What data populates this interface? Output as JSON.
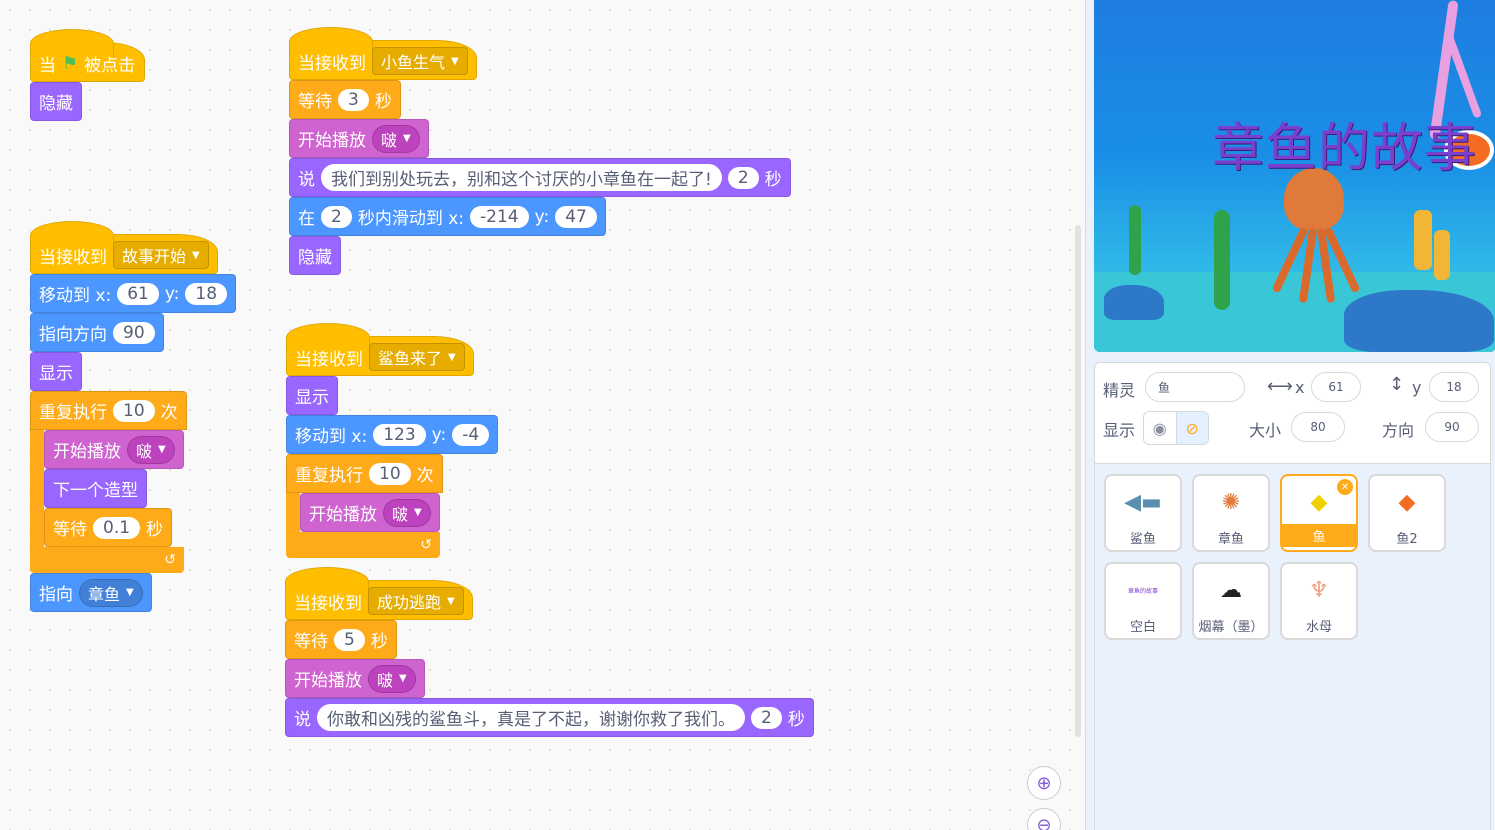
{
  "scripts": {
    "s1": {
      "hat_when": "当",
      "hat_clicked": "被点击",
      "hide": "隐藏"
    },
    "s2": {
      "hat": "当接收到",
      "msg": "故事开始",
      "goto": "移动到 x:",
      "x": "61",
      "y_lbl": "y:",
      "y": "18",
      "point_dir": "指向方向",
      "dir": "90",
      "show": "显示",
      "repeat": "重复执行",
      "times": "10",
      "times_unit": "次",
      "play": "开始播放",
      "sound": "啵",
      "next_costume": "下一个造型",
      "wait": "等待",
      "wait_val": "0.1",
      "sec": "秒",
      "point_towards": "指向",
      "target": "章鱼"
    },
    "s3": {
      "hat": "当接收到",
      "msg": "小鱼生气",
      "wait": "等待",
      "wait_val": "3",
      "sec": "秒",
      "play": "开始播放",
      "sound": "啵",
      "say": "说",
      "say_text": "我们到别处玩去，别和这个讨厌的小章鱼在一起了!",
      "say_secs": "2",
      "say_unit": "秒",
      "glide_in": "在",
      "glide_secs": "2",
      "glide_to": "秒内滑动到 x:",
      "gx": "-214",
      "gy_lbl": "y:",
      "gy": "47",
      "hide": "隐藏"
    },
    "s4": {
      "hat": "当接收到",
      "msg": "鲨鱼来了",
      "show": "显示",
      "goto": "移动到 x:",
      "x": "123",
      "y_lbl": "y:",
      "y": "-4",
      "repeat": "重复执行",
      "times": "10",
      "times_unit": "次",
      "play": "开始播放",
      "sound": "啵"
    },
    "s5": {
      "hat": "当接收到",
      "msg": "成功逃跑",
      "wait": "等待",
      "wait_val": "5",
      "sec": "秒",
      "play": "开始播放",
      "sound": "啵",
      "say": "说",
      "say_text": "你敢和凶残的鲨鱼斗，真是了不起，谢谢你救了我们。",
      "say_secs": "2",
      "say_unit": "秒"
    }
  },
  "stage": {
    "title": "章鱼的故事"
  },
  "sprite_info": {
    "sprite_label": "精灵",
    "sprite_name": "鱼",
    "x_label": "x",
    "x": "61",
    "y_label": "y",
    "y": "18",
    "show_label": "显示",
    "size_label": "大小",
    "size": "80",
    "direction_label": "方向",
    "direction": "90"
  },
  "sprites": [
    {
      "name": "鲨鱼",
      "icon": "shark-icon"
    },
    {
      "name": "章鱼",
      "icon": "octopus-icon"
    },
    {
      "name": "鱼",
      "icon": "fish-icon",
      "selected": true
    },
    {
      "name": "鱼2",
      "icon": "clownfish-icon"
    },
    {
      "name": "空白",
      "icon": "blank-icon",
      "thumb_text": "章鱼的故事"
    },
    {
      "name": "烟幕（墨）",
      "icon": "ink-icon"
    },
    {
      "name": "水母",
      "icon": "jellyfish-icon"
    }
  ],
  "colors": {
    "events": "#ffbf00",
    "control": "#ffab19",
    "looks": "#9966ff",
    "sound": "#cf63cf",
    "motion": "#4c97ff"
  }
}
